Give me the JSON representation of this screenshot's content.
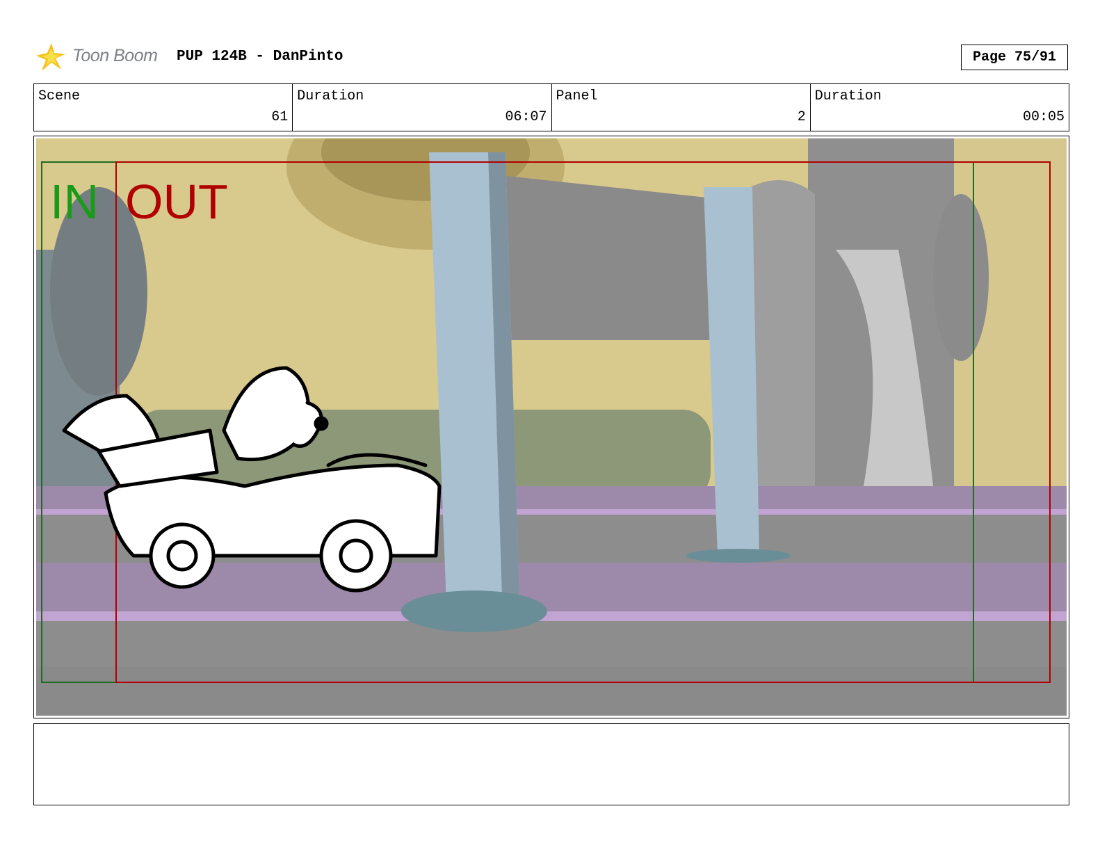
{
  "header": {
    "logo_text": "Toon Boom",
    "title": "PUP 124B - DanPinto",
    "page": "Page 75/91"
  },
  "info": {
    "scene_label": "Scene",
    "scene_value": "61",
    "scene_duration_label": "Duration",
    "scene_duration_value": "06:07",
    "panel_label": "Panel",
    "panel_value": "2",
    "panel_duration_label": "Duration",
    "panel_duration_value": "00:05"
  },
  "panel": {
    "in_label": "IN",
    "out_label": "OUT",
    "colors": {
      "in": "#1a9a1a",
      "out": "#b00000",
      "wall": "#d9c98a",
      "floor": "#8c8c8c",
      "stripe": "#b59ac9"
    }
  },
  "notes": {
    "text": ""
  }
}
